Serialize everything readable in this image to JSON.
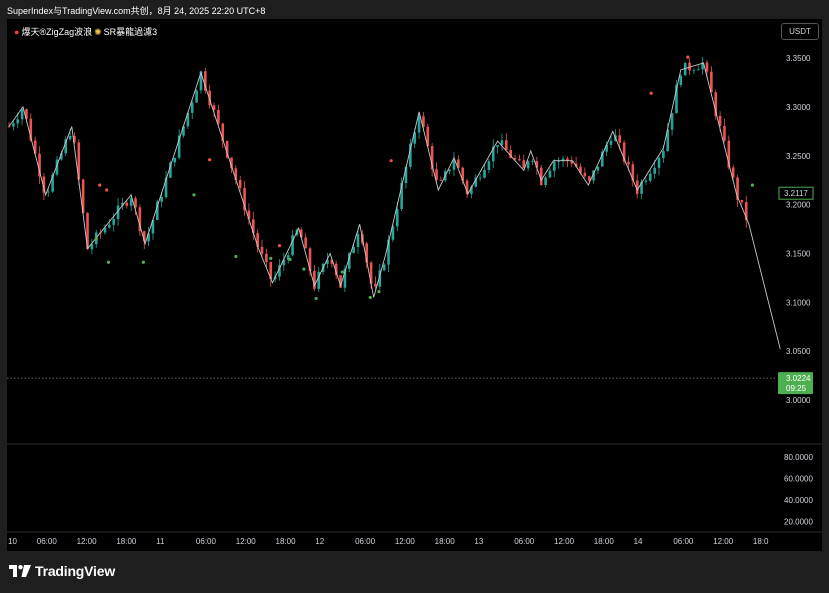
{
  "header": {
    "title": "SuperIndex与TradingView.com共创，8月 24, 2025 22:20 UTC+8"
  },
  "indicators": {
    "label_prefix": "爆天",
    "zigzag_label": "®ZigZag波浪",
    "sr_label": "SR暴龍過濾3"
  },
  "currency_badge": "USDT",
  "footer": {
    "logo_text": "TradingView"
  },
  "colors": {
    "background": "#000000",
    "up": "#26a69a",
    "down": "#ef5350",
    "zigzag": "#c8c8c8",
    "last_price": "#4caf50"
  },
  "chart_data": {
    "type": "candlestick",
    "price_axis": {
      "ticks": [
        "3.3500",
        "3.3000",
        "3.2500",
        "3.2000",
        "3.1500",
        "3.1000",
        "3.0500",
        "3.0000"
      ],
      "range": [
        2.955,
        3.39
      ]
    },
    "last_price": {
      "value": "3.0224",
      "countdown": "09:25"
    },
    "current_value_label": "3.2117",
    "oscillator_axis": {
      "ticks": [
        "80.0000",
        "60.0000",
        "40.0000",
        "20.0000"
      ],
      "range": [
        10,
        90
      ]
    },
    "time_axis": [
      "10",
      "06:00",
      "12:00",
      "18:00",
      "11",
      "06:00",
      "12:00",
      "18:00",
      "12",
      "06:00",
      "12:00",
      "18:00",
      "13",
      "06:00",
      "12:00",
      "18:00",
      "14",
      "06:00",
      "12:00",
      "18:0"
    ],
    "zigzag_pivots": [
      [
        0,
        3.28
      ],
      [
        0.8,
        3.3
      ],
      [
        2.1,
        3.21
      ],
      [
        3.6,
        3.28
      ],
      [
        4.5,
        3.155
      ],
      [
        7.0,
        3.21
      ],
      [
        7.8,
        3.16
      ],
      [
        11.0,
        3.335
      ],
      [
        14.3,
        3.155
      ],
      [
        15.1,
        3.12
      ],
      [
        16.6,
        3.176
      ],
      [
        17.5,
        3.117
      ],
      [
        18.4,
        3.15
      ],
      [
        19.0,
        3.117
      ],
      [
        20.1,
        3.18
      ],
      [
        20.9,
        3.105
      ],
      [
        21.6,
        3.15
      ],
      [
        23.5,
        3.295
      ],
      [
        24.6,
        3.215
      ],
      [
        25.5,
        3.248
      ],
      [
        26.3,
        3.211
      ],
      [
        27.2,
        3.24
      ],
      [
        28.0,
        3.265
      ],
      [
        29.5,
        3.235
      ],
      [
        29.9,
        3.255
      ],
      [
        30.5,
        3.225
      ],
      [
        31.2,
        3.245
      ],
      [
        32.3,
        3.245
      ],
      [
        33.2,
        3.22
      ],
      [
        34.6,
        3.275
      ],
      [
        36.0,
        3.215
      ],
      [
        37.5,
        3.258
      ],
      [
        38.5,
        3.338
      ],
      [
        39.8,
        3.345
      ],
      [
        41.7,
        3.21
      ],
      [
        42.4,
        3.18
      ],
      [
        44.2,
        3.052
      ]
    ],
    "markers_green": [
      [
        5.0,
        3.165
      ],
      [
        5.7,
        3.141
      ],
      [
        7.7,
        3.141
      ],
      [
        10.6,
        3.21
      ],
      [
        13.0,
        3.147
      ],
      [
        15.0,
        3.145
      ],
      [
        16.1,
        3.144
      ],
      [
        16.9,
        3.134
      ],
      [
        17.6,
        3.104
      ],
      [
        19.1,
        3.131
      ],
      [
        20.7,
        3.105
      ],
      [
        21.2,
        3.111
      ],
      [
        42.6,
        3.22
      ]
    ],
    "markers_red": [
      [
        5.2,
        3.22
      ],
      [
        5.6,
        3.215
      ],
      [
        11.5,
        3.246
      ],
      [
        15.5,
        3.158
      ],
      [
        21.9,
        3.245
      ],
      [
        36.8,
        3.314
      ],
      [
        38.9,
        3.351
      ]
    ]
  }
}
